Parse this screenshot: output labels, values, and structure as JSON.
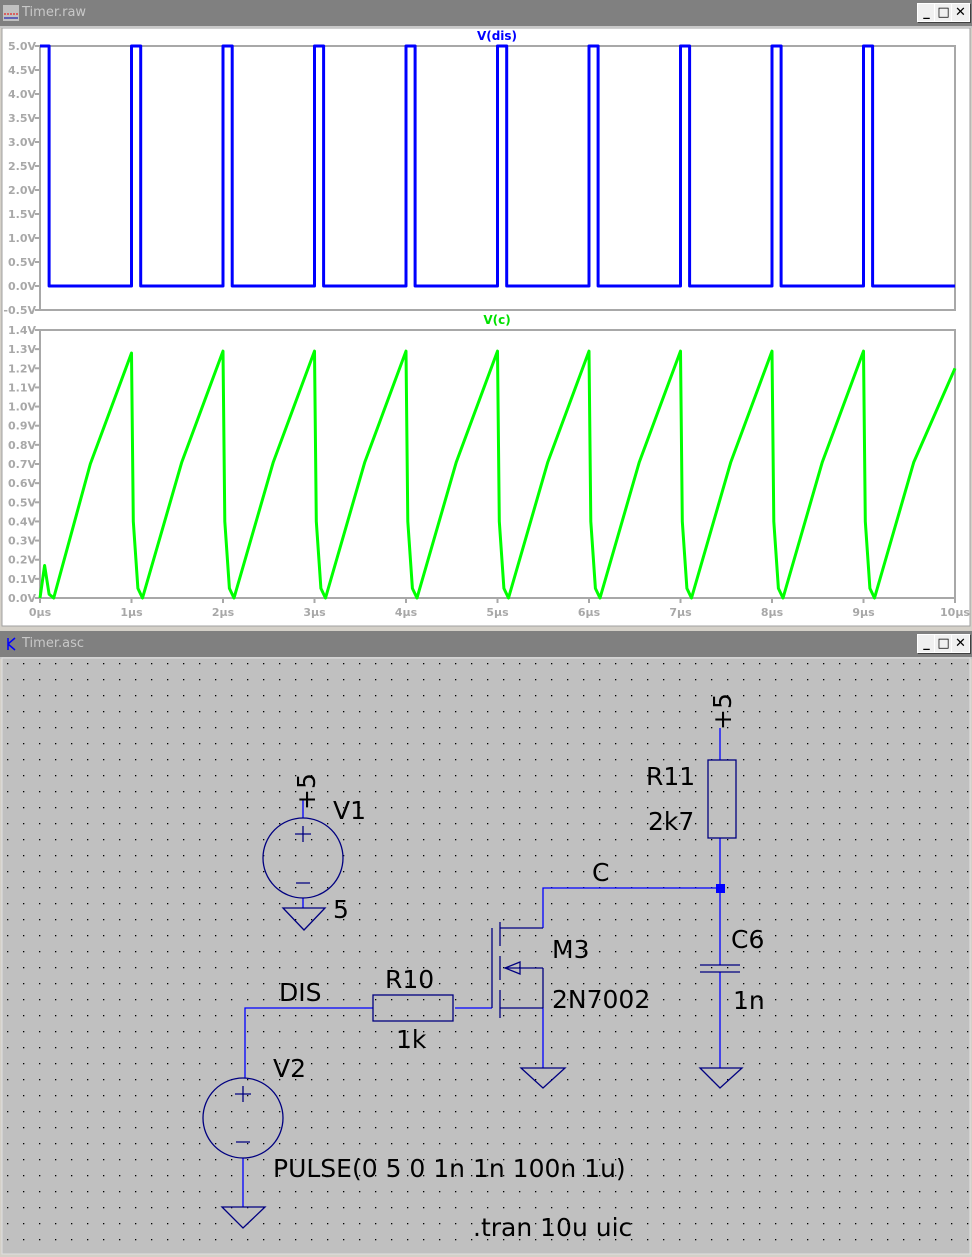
{
  "waveform_window": {
    "title": "Timer.raw",
    "buttons": {
      "minimize": "_",
      "maximize": "□",
      "close": "✕"
    }
  },
  "schematic_window": {
    "title": "Timer.asc",
    "buttons": {
      "minimize": "_",
      "maximize": "□",
      "close": "✕"
    }
  },
  "colors": {
    "vdis": "#0000ff",
    "vc": "#00ff00",
    "wire": "#0000ff",
    "component": "#000080",
    "schematic_bg": "#c0c0c0",
    "axis": "#a8a8a8"
  },
  "chart_data": [
    {
      "type": "line",
      "title": "V(dis)",
      "ylim": [
        -0.5,
        5.0
      ],
      "xlim": [
        0,
        10
      ],
      "yticks": [
        "5.0V",
        "4.5V",
        "4.0V",
        "3.5V",
        "3.0V",
        "2.5V",
        "2.0V",
        "1.5V",
        "1.0V",
        "0.5V",
        "0.0V",
        "-0.5V"
      ],
      "series": [
        {
          "name": "V(dis)",
          "color": "#0000ff",
          "points": [
            [
              0,
              5
            ],
            [
              0.1,
              5
            ],
            [
              0.1,
              0
            ],
            [
              1.0,
              0
            ],
            [
              1.0,
              5
            ],
            [
              1.1,
              5
            ],
            [
              1.1,
              0
            ],
            [
              2.0,
              0
            ],
            [
              2.0,
              5
            ],
            [
              2.1,
              5
            ],
            [
              2.1,
              0
            ],
            [
              3.0,
              0
            ],
            [
              3.0,
              5
            ],
            [
              3.1,
              5
            ],
            [
              3.1,
              0
            ],
            [
              4.0,
              0
            ],
            [
              4.0,
              5
            ],
            [
              4.1,
              5
            ],
            [
              4.1,
              0
            ],
            [
              5.0,
              0
            ],
            [
              5.0,
              5
            ],
            [
              5.1,
              5
            ],
            [
              5.1,
              0
            ],
            [
              6.0,
              0
            ],
            [
              6.0,
              5
            ],
            [
              6.1,
              5
            ],
            [
              6.1,
              0
            ],
            [
              7.0,
              0
            ],
            [
              7.0,
              5
            ],
            [
              7.1,
              5
            ],
            [
              7.1,
              0
            ],
            [
              8.0,
              0
            ],
            [
              8.0,
              5
            ],
            [
              8.1,
              5
            ],
            [
              8.1,
              0
            ],
            [
              9.0,
              0
            ],
            [
              9.0,
              5
            ],
            [
              9.1,
              5
            ],
            [
              9.1,
              0
            ],
            [
              10.0,
              0
            ]
          ]
        }
      ]
    },
    {
      "type": "line",
      "title": "V(c)",
      "ylim": [
        0.0,
        1.4
      ],
      "xlim": [
        0,
        10
      ],
      "yticks": [
        "1.4V",
        "1.3V",
        "1.2V",
        "1.1V",
        "1.0V",
        "0.9V",
        "0.8V",
        "0.7V",
        "0.6V",
        "0.5V",
        "0.4V",
        "0.3V",
        "0.2V",
        "0.1V",
        "0.0V"
      ],
      "xticks": [
        "0µs",
        "1µs",
        "2µs",
        "3µs",
        "4µs",
        "5µs",
        "6µs",
        "7µs",
        "8µs",
        "9µs",
        "10µs"
      ],
      "series": [
        {
          "name": "V(c)",
          "color": "#00ff00",
          "points": [
            [
              0,
              0
            ],
            [
              0.05,
              0.17
            ],
            [
              0.1,
              0.02
            ],
            [
              0.15,
              0.0
            ],
            [
              0.55,
              0.7
            ],
            [
              1.0,
              1.28
            ],
            [
              1.02,
              0.4
            ],
            [
              1.07,
              0.05
            ],
            [
              1.12,
              0.0
            ],
            [
              1.55,
              0.71
            ],
            [
              2.0,
              1.29
            ],
            [
              2.02,
              0.4
            ],
            [
              2.07,
              0.05
            ],
            [
              2.12,
              0.0
            ],
            [
              2.55,
              0.71
            ],
            [
              3.0,
              1.29
            ],
            [
              3.02,
              0.4
            ],
            [
              3.07,
              0.05
            ],
            [
              3.12,
              0.0
            ],
            [
              3.55,
              0.71
            ],
            [
              4.0,
              1.29
            ],
            [
              4.02,
              0.4
            ],
            [
              4.07,
              0.05
            ],
            [
              4.12,
              0.0
            ],
            [
              4.55,
              0.71
            ],
            [
              5.0,
              1.29
            ],
            [
              5.02,
              0.4
            ],
            [
              5.07,
              0.05
            ],
            [
              5.12,
              0.0
            ],
            [
              5.55,
              0.71
            ],
            [
              6.0,
              1.29
            ],
            [
              6.02,
              0.4
            ],
            [
              6.07,
              0.05
            ],
            [
              6.12,
              0.0
            ],
            [
              6.55,
              0.71
            ],
            [
              7.0,
              1.29
            ],
            [
              7.02,
              0.4
            ],
            [
              7.07,
              0.05
            ],
            [
              7.12,
              0.0
            ],
            [
              7.55,
              0.71
            ],
            [
              8.0,
              1.29
            ],
            [
              8.02,
              0.4
            ],
            [
              8.07,
              0.05
            ],
            [
              8.12,
              0.0
            ],
            [
              8.55,
              0.71
            ],
            [
              9.0,
              1.29
            ],
            [
              9.02,
              0.4
            ],
            [
              9.07,
              0.05
            ],
            [
              9.12,
              0.0
            ],
            [
              9.55,
              0.71
            ],
            [
              10.0,
              1.2
            ]
          ]
        }
      ]
    }
  ],
  "schematic": {
    "v1_supply": "+5",
    "v1_name": "V1",
    "v1_value": "5",
    "r11_supply": "+5",
    "r11_name": "R11",
    "r11_value": "2k7",
    "net_c": "C",
    "c6_name": "C6",
    "c6_value": "1n",
    "m3_name": "M3",
    "m3_model": "2N7002",
    "net_dis": "DIS",
    "r10_name": "R10",
    "r10_value": "1k",
    "v2_name": "V2",
    "v2_value": "PULSE(0 5 0 1n 1n 100n 1u)",
    "directive": ".tran 10u uic"
  }
}
